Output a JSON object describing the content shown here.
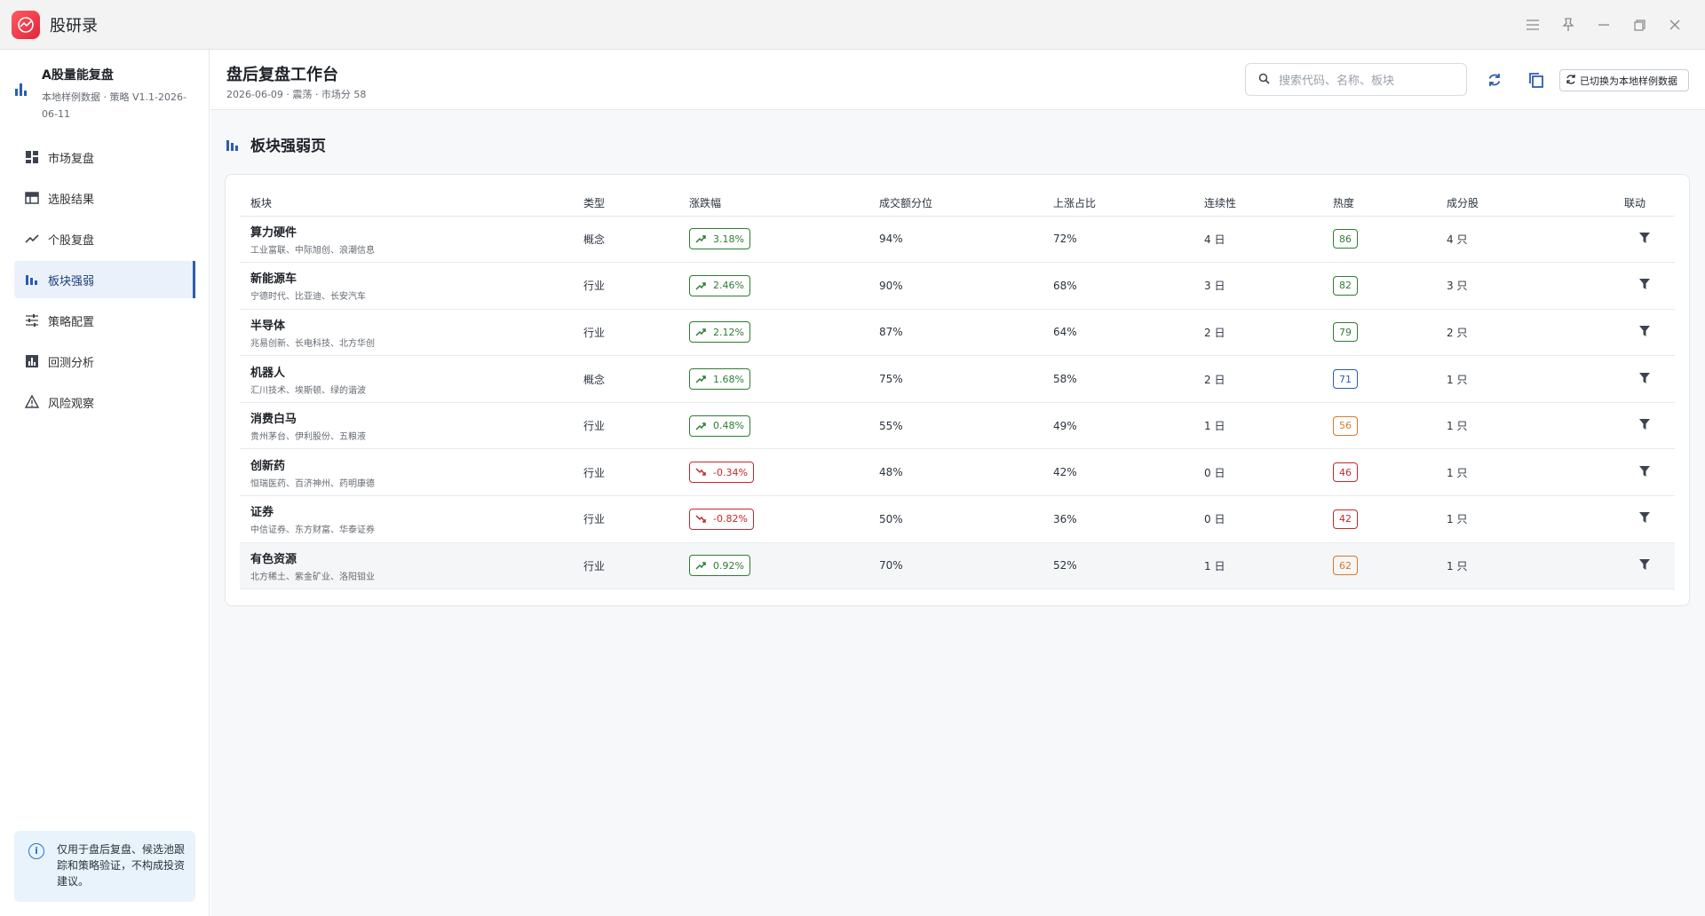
{
  "app": {
    "title": "股研录"
  },
  "sidebar": {
    "brand_title": "A股量能复盘",
    "brand_subtitle": "本地样例数据 · 策略 V1.1-2026-06-11",
    "items": [
      {
        "label": "市场复盘",
        "icon": "dashboard-icon"
      },
      {
        "label": "选股结果",
        "icon": "table-icon"
      },
      {
        "label": "个股复盘",
        "icon": "trend-icon"
      },
      {
        "label": "板块强弱",
        "icon": "bar-chart-icon",
        "active": true
      },
      {
        "label": "策略配置",
        "icon": "sliders-icon"
      },
      {
        "label": "回测分析",
        "icon": "report-chart-icon"
      },
      {
        "label": "风险观察",
        "icon": "warning-icon"
      }
    ],
    "notice": "仅用于盘后复盘、候选池跟踪和策略验证，不构成投资建议。"
  },
  "header": {
    "title": "盘后复盘工作台",
    "subtitle": "2026-06-09 · 震荡 · 市场分 58",
    "search_placeholder": "搜索代码、名称、板块",
    "switch_label": "已切换为本地样例数据"
  },
  "section": {
    "title": "板块强弱页"
  },
  "table": {
    "columns": [
      "板块",
      "类型",
      "涨跌幅",
      "成交额分位",
      "上涨占比",
      "连续性",
      "热度",
      "成分股",
      "联动"
    ],
    "rows": [
      {
        "name": "算力硬件",
        "stocks": "工业富联、中际旭创、浪潮信息",
        "type": "概念",
        "change": "3.18%",
        "direction": "up",
        "turnover_pct": "94%",
        "up_ratio": "72%",
        "streak": "4 日",
        "heat": "86",
        "heat_color": "#2e7d32",
        "members": "4 只"
      },
      {
        "name": "新能源车",
        "stocks": "宁德时代、比亚迪、长安汽车",
        "type": "行业",
        "change": "2.46%",
        "direction": "up",
        "turnover_pct": "90%",
        "up_ratio": "68%",
        "streak": "3 日",
        "heat": "82",
        "heat_color": "#2e7d32",
        "members": "3 只"
      },
      {
        "name": "半导体",
        "stocks": "兆易创新、长电科技、北方华创",
        "type": "行业",
        "change": "2.12%",
        "direction": "up",
        "turnover_pct": "87%",
        "up_ratio": "64%",
        "streak": "2 日",
        "heat": "79",
        "heat_color": "#2e7d32",
        "members": "2 只"
      },
      {
        "name": "机器人",
        "stocks": "汇川技术、埃斯顿、绿的谐波",
        "type": "概念",
        "change": "1.68%",
        "direction": "up",
        "turnover_pct": "75%",
        "up_ratio": "58%",
        "streak": "2 日",
        "heat": "71",
        "heat_color": "#2a5db0",
        "members": "1 只"
      },
      {
        "name": "消费白马",
        "stocks": "贵州茅台、伊利股份、五粮液",
        "type": "行业",
        "change": "0.48%",
        "direction": "up",
        "turnover_pct": "55%",
        "up_ratio": "49%",
        "streak": "1 日",
        "heat": "56",
        "heat_color": "#d9782b",
        "members": "1 只"
      },
      {
        "name": "创新药",
        "stocks": "恒瑞医药、百济神州、药明康德",
        "type": "行业",
        "change": "-0.34%",
        "direction": "down",
        "turnover_pct": "48%",
        "up_ratio": "42%",
        "streak": "0 日",
        "heat": "46",
        "heat_color": "#c62828",
        "members": "1 只"
      },
      {
        "name": "证券",
        "stocks": "中信证券、东方财富、华泰证券",
        "type": "行业",
        "change": "-0.82%",
        "direction": "down",
        "turnover_pct": "50%",
        "up_ratio": "36%",
        "streak": "0 日",
        "heat": "42",
        "heat_color": "#c62828",
        "members": "1 只"
      },
      {
        "name": "有色资源",
        "stocks": "北方稀土、紫金矿业、洛阳钼业",
        "type": "行业",
        "change": "0.92%",
        "direction": "up",
        "turnover_pct": "70%",
        "up_ratio": "52%",
        "streak": "1 日",
        "heat": "62",
        "heat_color": "#d9782b",
        "members": "1 只"
      }
    ]
  }
}
